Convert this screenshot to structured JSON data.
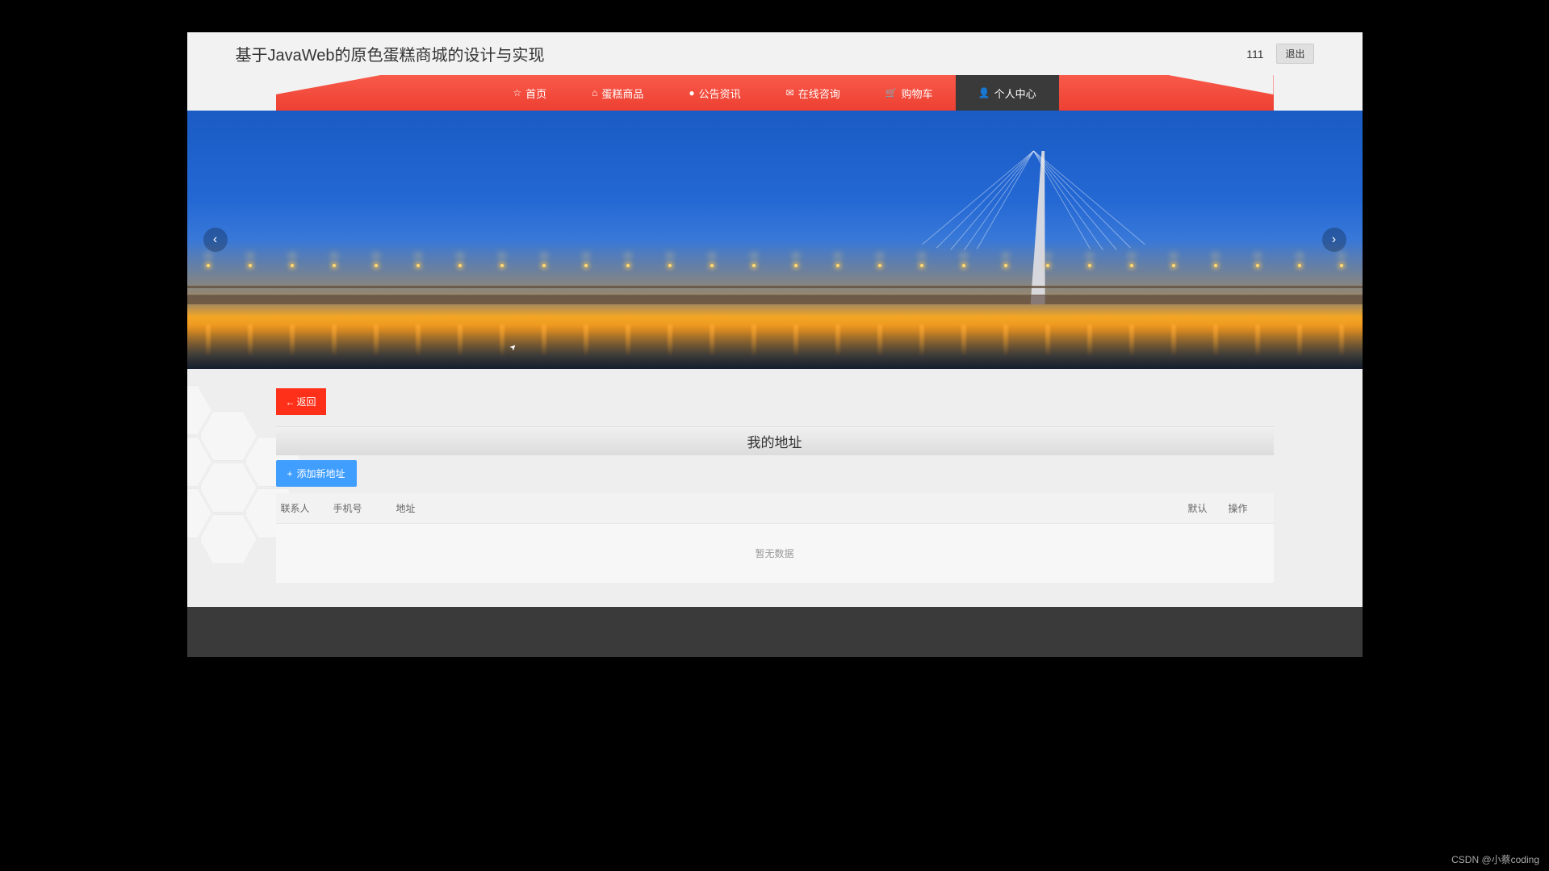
{
  "header": {
    "title": "基于JavaWeb的原色蛋糕商城的设计与实现",
    "username": "111",
    "logout": "退出"
  },
  "nav": {
    "items": [
      {
        "icon": "☆",
        "label": "首页"
      },
      {
        "icon": "⌂",
        "label": "蛋糕商品"
      },
      {
        "icon": "●",
        "label": "公告资讯"
      },
      {
        "icon": "✉",
        "label": "在线咨询"
      },
      {
        "icon": "🛒",
        "label": "购物车"
      },
      {
        "icon": "👤",
        "label": "个人中心"
      }
    ],
    "active_index": 5
  },
  "banner": {
    "arrow_left": "‹",
    "arrow_right": "›"
  },
  "content": {
    "back_label": "返回",
    "page_title": "我的地址",
    "add_label": "添加新地址",
    "columns": {
      "contact": "联系人",
      "phone": "手机号",
      "address": "地址",
      "default": "默认",
      "action": "操作"
    },
    "empty_text": "暂无数据"
  },
  "watermark": "CSDN @小蔡coding"
}
